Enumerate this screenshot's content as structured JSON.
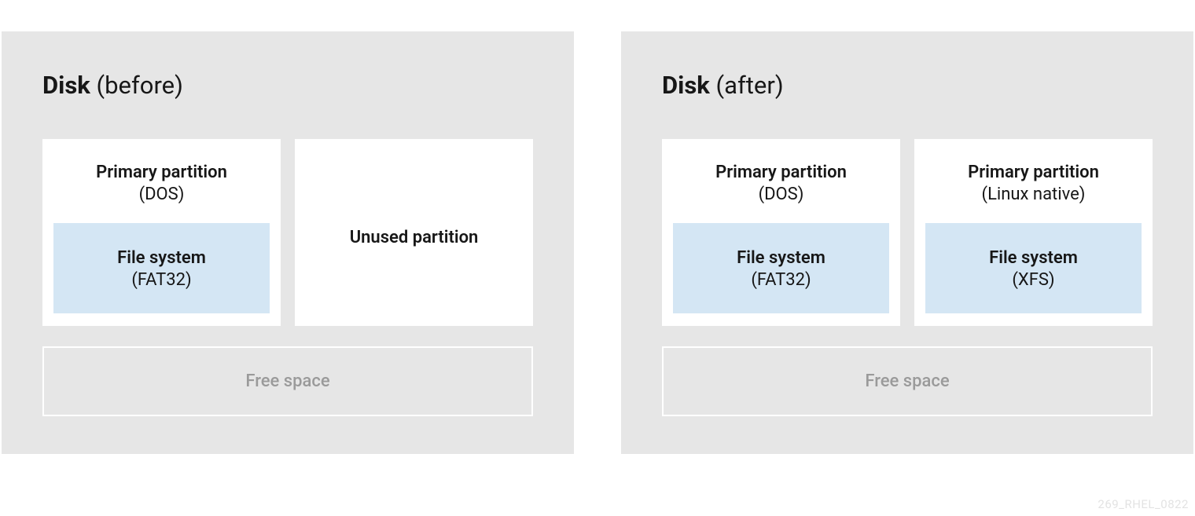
{
  "before": {
    "title_bold": "Disk",
    "title_rest": " (before)",
    "partitions": [
      {
        "label": "Primary partition",
        "sub": "(DOS)",
        "fs_label": "File system",
        "fs_sub": "(FAT32)"
      },
      {
        "label": "Unused partition"
      }
    ],
    "free_space": "Free space"
  },
  "after": {
    "title_bold": "Disk",
    "title_rest": " (after)",
    "partitions": [
      {
        "label": "Primary partition",
        "sub": "(DOS)",
        "fs_label": "File system",
        "fs_sub": "(FAT32)"
      },
      {
        "label": "Primary partition",
        "sub": "(Linux native)",
        "fs_label": "File system",
        "fs_sub": "(XFS)"
      }
    ],
    "free_space": "Free space"
  },
  "watermark": "269_RHEL_0822"
}
